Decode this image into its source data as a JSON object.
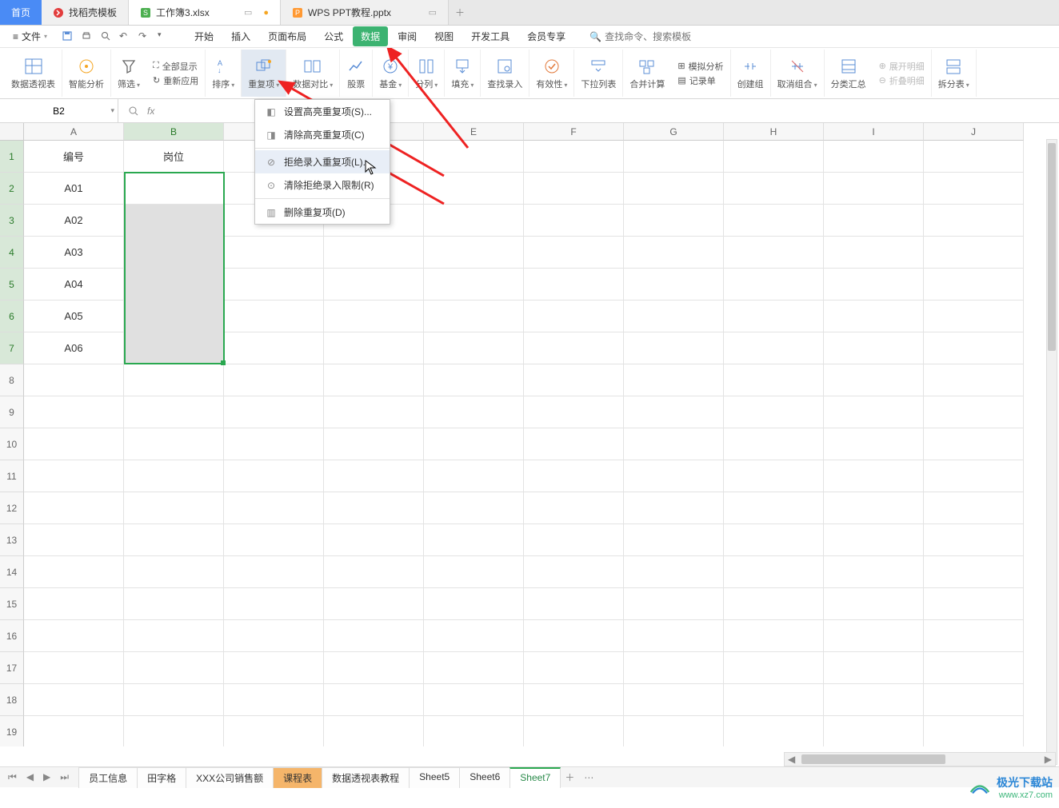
{
  "tabs": {
    "home": "首页",
    "items": [
      {
        "label": "找稻壳模板",
        "color": "#e23c3c"
      },
      {
        "label": "工作簿3.xlsx",
        "color": "#4caf50",
        "active": true
      },
      {
        "label": "WPS PPT教程.pptx",
        "color": "#ff9933"
      }
    ]
  },
  "file_menu": "文件",
  "menus": [
    "开始",
    "插入",
    "页面布局",
    "公式",
    "数据",
    "审阅",
    "视图",
    "开发工具",
    "会员专享"
  ],
  "menu_active_index": 4,
  "search_placeholder": "查找命令、搜索模板",
  "ribbon": {
    "pivot": "数据透视表",
    "ai": "智能分析",
    "filter": "筛选",
    "show_all": "全部显示",
    "reapply": "重新应用",
    "sort": "排序",
    "dup": "重复项",
    "compare": "数据对比",
    "stock": "股票",
    "fund": "基金",
    "split": "分列",
    "fill": "填充",
    "find_entry": "查找录入",
    "validity": "有效性",
    "dropdown_list": "下拉列表",
    "consolidate": "合并计算",
    "sim": "模拟分析",
    "record": "记录单",
    "group": "创建组",
    "ungroup": "取消组合",
    "subtotal": "分类汇总",
    "expand": "展开明细",
    "collapse": "折叠明细",
    "split_table": "拆分表"
  },
  "dup_menu": [
    "设置高亮重复项(S)...",
    "清除高亮重复项(C)",
    "拒绝录入重复项(L)...",
    "清除拒绝录入限制(R)",
    "删除重复项(D)"
  ],
  "namebox": "B2",
  "columns": [
    "A",
    "B",
    "C",
    "D",
    "E",
    "F",
    "G",
    "H",
    "I",
    "J"
  ],
  "rows_shown": 19,
  "selected_rows": [
    1,
    2,
    3,
    4,
    5,
    6,
    7
  ],
  "cell_data": {
    "headers": {
      "A": "编号",
      "B": "岗位"
    },
    "colA": [
      "A01",
      "A02",
      "A03",
      "A04",
      "A05",
      "A06"
    ]
  },
  "sheets": [
    "员工信息",
    "田字格",
    "XXX公司销售额",
    "课程表",
    "数据透视表教程",
    "Sheet5",
    "Sheet6",
    "Sheet7"
  ],
  "sheet_active_index": 7,
  "sheet_orange_index": 3,
  "watermark": {
    "line1": "极光下载站",
    "line2": "www.xz7.com"
  }
}
